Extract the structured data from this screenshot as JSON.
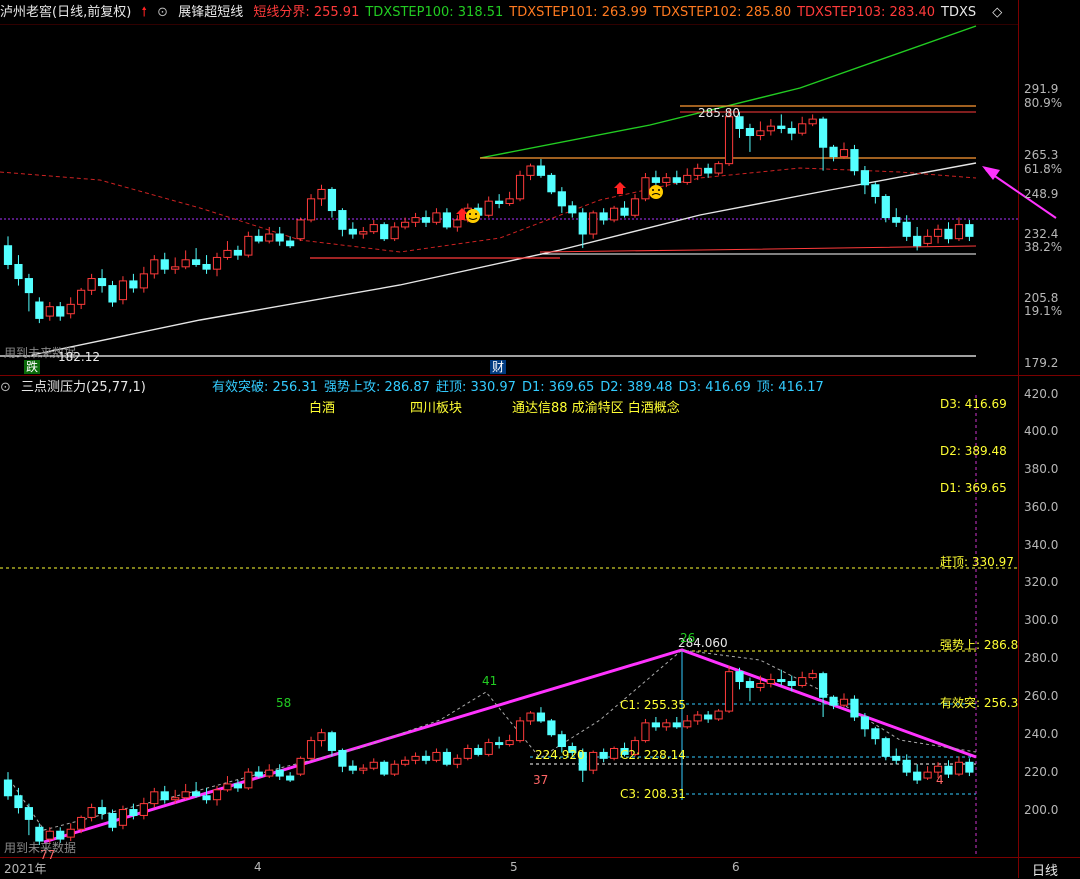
{
  "header_top": {
    "stock": "泸州老窖(日线,前复权)",
    "indicator": "展锋超短线",
    "items": [
      {
        "label": "短线分界: 255.91",
        "color": "#ff3b3b"
      },
      {
        "label": "TDXSTEP100: 318.51",
        "color": "#22cc22"
      },
      {
        "label": "TDXSTEP101: 263.99",
        "color": "#ff7a20"
      },
      {
        "label": "TDXSTEP102: 285.80",
        "color": "#ff7a20"
      },
      {
        "label": "TDXSTEP103: 283.40",
        "color": "#ff3b3b"
      },
      {
        "label": "TDXS",
        "color": "#e8e8e8"
      }
    ]
  },
  "header_bottom": {
    "indicator": "三点测压力(25,77,1)",
    "items": [
      {
        "label": "有效突破: 256.31",
        "color": "#33ccff"
      },
      {
        "label": "强势上攻: 286.87",
        "color": "#33ccff"
      },
      {
        "label": "赶顶: 330.97",
        "color": "#33ccff"
      },
      {
        "label": "D1: 369.65",
        "color": "#33ccff"
      },
      {
        "label": "D2: 389.48",
        "color": "#33ccff"
      },
      {
        "label": "D3: 416.69",
        "color": "#33ccff"
      },
      {
        "label": "顶: 416.17",
        "color": "#33ccff"
      }
    ],
    "concepts": [
      "白酒",
      "四川板块",
      "通达信88 成渝特区 白酒概念"
    ]
  },
  "top_axis": [
    "291.9",
    "80.9%",
    "265.3",
    "61.8%",
    "248.9",
    "232.4",
    "38.2%",
    "205.8",
    "19.1%",
    "179.2"
  ],
  "bottom_axis": [
    "420.0",
    "400.0",
    "380.0",
    "360.0",
    "340.0",
    "320.0",
    "300.0",
    "280.0",
    "260.0",
    "240.0",
    "220.0",
    "200.0"
  ],
  "x_axis": [
    "2021年",
    "4",
    "5",
    "6",
    "日线"
  ],
  "top_annotations": {
    "hi_label": "285.80",
    "unused": "用到未来数据",
    "lo_label": "182.12",
    "die": "跌",
    "cai": "财"
  },
  "bottom_annotations": {
    "d3": "D3: 416.69",
    "d2": "D2: 389.48",
    "d1": "D1: 369.65",
    "gan": "赶顶: 330.97",
    "qiang": "强势上: 286.8",
    "youxiao": "有效突: 256.3",
    "c1": "C1: 255.35",
    "c2": "C2: 228.14",
    "c3": "C3: 208.31",
    "peak": "284.060",
    "low": "224.920",
    "n58": "58",
    "n41": "41",
    "n26": "26",
    "n37": "37",
    "n4": "4",
    "n77": "77",
    "unused": "用到未来数据"
  },
  "chart_data": {
    "type": "candlestick",
    "candles": [
      [
        228,
        220,
        232,
        218
      ],
      [
        220,
        214,
        224,
        211
      ],
      [
        214,
        208,
        216,
        200
      ],
      [
        204,
        197,
        206,
        195
      ],
      [
        198,
        202,
        204,
        196
      ],
      [
        202,
        198,
        204,
        196
      ],
      [
        199,
        203,
        206,
        197
      ],
      [
        203,
        209,
        210,
        201
      ],
      [
        209,
        214,
        216,
        207
      ],
      [
        214,
        211,
        218,
        208
      ],
      [
        211,
        204,
        213,
        202
      ],
      [
        205,
        213,
        215,
        203
      ],
      [
        213,
        210,
        216,
        208
      ],
      [
        210,
        216,
        219,
        208
      ],
      [
        216,
        222,
        224,
        214
      ],
      [
        222,
        218,
        225,
        216
      ],
      [
        218,
        219,
        223,
        216
      ],
      [
        219,
        222,
        226,
        218
      ],
      [
        222,
        220,
        227,
        219
      ],
      [
        220,
        218,
        224,
        216
      ],
      [
        218,
        223,
        225,
        215
      ],
      [
        223,
        226,
        230,
        222
      ],
      [
        226,
        224,
        228,
        222
      ],
      [
        224,
        232,
        234,
        223
      ],
      [
        232,
        230,
        235,
        229
      ],
      [
        230,
        233,
        236,
        229
      ],
      [
        233,
        230,
        236,
        228
      ],
      [
        230,
        228,
        232,
        227
      ],
      [
        231,
        239,
        240,
        230
      ],
      [
        239,
        248,
        250,
        238
      ],
      [
        248,
        252,
        254,
        245
      ],
      [
        252,
        243,
        253,
        240
      ],
      [
        243,
        235,
        244,
        232
      ],
      [
        235,
        233,
        238,
        231
      ],
      [
        233,
        234,
        236,
        231
      ],
      [
        234,
        237,
        239,
        233
      ],
      [
        237,
        231,
        238,
        230
      ],
      [
        231,
        236,
        238,
        230
      ],
      [
        236,
        238,
        240,
        235
      ],
      [
        238,
        240,
        242,
        236
      ],
      [
        240,
        238,
        243,
        236
      ],
      [
        238,
        242,
        244,
        237
      ],
      [
        242,
        236,
        244,
        235
      ],
      [
        236,
        239,
        241,
        234
      ],
      [
        239,
        244,
        246,
        238
      ],
      [
        244,
        241,
        246,
        240
      ],
      [
        241,
        247,
        249,
        240
      ],
      [
        247,
        246,
        250,
        244
      ],
      [
        246,
        248,
        251,
        245
      ],
      [
        248,
        258,
        260,
        247
      ],
      [
        258,
        262,
        263,
        256
      ],
      [
        262,
        258,
        265,
        257
      ],
      [
        258,
        251,
        259,
        250
      ],
      [
        251,
        245,
        253,
        242
      ],
      [
        245,
        242,
        247,
        240
      ],
      [
        242,
        233,
        244,
        227
      ],
      [
        233,
        242,
        243,
        231
      ],
      [
        242,
        239,
        244,
        237
      ],
      [
        239,
        244,
        245,
        238
      ],
      [
        244,
        241,
        247,
        240
      ],
      [
        241,
        248,
        250,
        240
      ],
      [
        248,
        257,
        259,
        247
      ],
      [
        257,
        255,
        260,
        253
      ],
      [
        255,
        257,
        259,
        253
      ],
      [
        257,
        255,
        260,
        254
      ],
      [
        255,
        258,
        261,
        254
      ],
      [
        258,
        261,
        263,
        256
      ],
      [
        261,
        259,
        263,
        257
      ],
      [
        259,
        263,
        264,
        258
      ],
      [
        263,
        283,
        286,
        262
      ],
      [
        283,
        278,
        285,
        274
      ],
      [
        278,
        275,
        280,
        268
      ],
      [
        275,
        277,
        281,
        273
      ],
      [
        277,
        279,
        282,
        275
      ],
      [
        279,
        278,
        284,
        276
      ],
      [
        278,
        276,
        281,
        273
      ],
      [
        276,
        280,
        283,
        275
      ],
      [
        280,
        282,
        284,
        279
      ],
      [
        282,
        270,
        283,
        260
      ],
      [
        270,
        266,
        271,
        264
      ],
      [
        266,
        269,
        272,
        265
      ],
      [
        269,
        260,
        271,
        258
      ],
      [
        260,
        254,
        262,
        250
      ],
      [
        254,
        249,
        255,
        246
      ],
      [
        249,
        240,
        250,
        238
      ],
      [
        240,
        238,
        244,
        236
      ],
      [
        238,
        232,
        241,
        230
      ],
      [
        232,
        228,
        236,
        226
      ],
      [
        229,
        232,
        235,
        228
      ],
      [
        232,
        235,
        237,
        229
      ],
      [
        235,
        231,
        238,
        229
      ],
      [
        231,
        237,
        240,
        230
      ],
      [
        237,
        232,
        239,
        230
      ]
    ],
    "bull_color": "#ff3b3b",
    "bear_color": "#54ffff",
    "top_range": [
      175,
      320
    ],
    "bottom_range": [
      195,
      425
    ]
  }
}
